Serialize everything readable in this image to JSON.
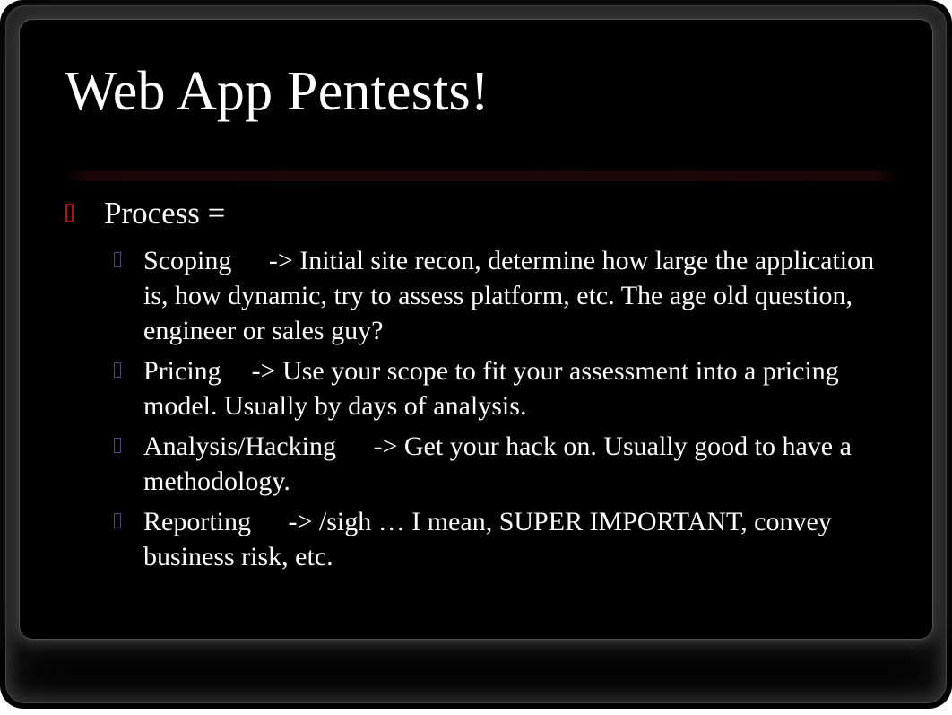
{
  "slide": {
    "title": "Web App Pentests!",
    "divider": {
      "color": "#1d0609"
    },
    "background_color": "#000000",
    "text_color": "#ffffff",
    "bullets": [
      {
        "level": 1,
        "marker": "tofu-box-red",
        "marker_color": "#b31212",
        "text": "Process ="
      }
    ],
    "sub_bullets": [
      {
        "level": 2,
        "marker": "tofu-box-blue",
        "marker_color": "#4b4b7d",
        "text": "Scoping\t -> Initial site recon, determine how large the application is, how dynamic, try to assess platform, etc. The age old question, engineer or sales guy?"
      },
      {
        "level": 2,
        "marker": "tofu-box-blue",
        "marker_color": "#4b4b7d",
        "text": "Pricing\t-> Use your scope to fit your assessment into a pricing model. Usually by days of analysis."
      },
      {
        "level": 2,
        "marker": "tofu-box-blue",
        "marker_color": "#4b4b7d",
        "text": "Analysis/Hacking\t -> Get your hack on. Usually good to have a methodology."
      },
      {
        "level": 2,
        "marker": "tofu-box-blue",
        "marker_color": "#4b4b7d",
        "text": "Reporting\t -> /sigh … I mean, SUPER IMPORTANT, convey business risk, etc."
      }
    ]
  }
}
